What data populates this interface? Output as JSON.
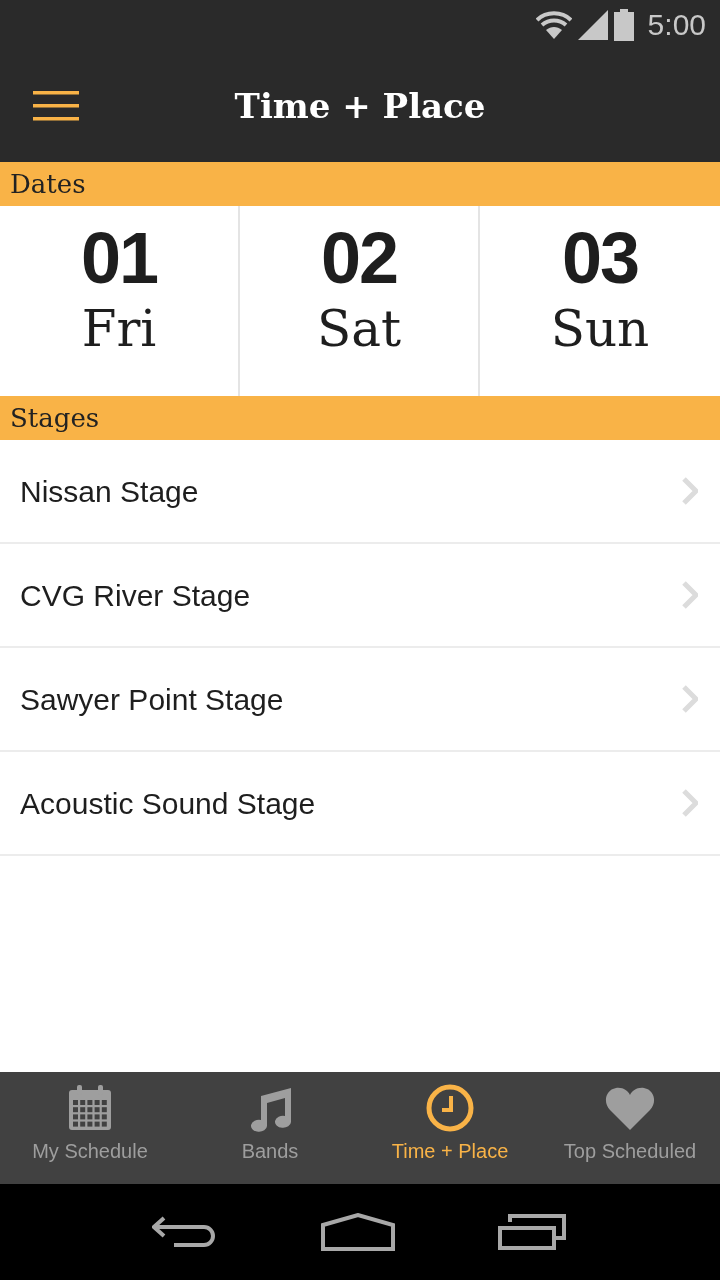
{
  "status_bar": {
    "time": "5:00"
  },
  "app_bar": {
    "title": "Time + Place"
  },
  "dates": {
    "header": "Dates",
    "items": [
      {
        "number": "01",
        "day": "Fri"
      },
      {
        "number": "02",
        "day": "Sat"
      },
      {
        "number": "03",
        "day": "Sun"
      }
    ]
  },
  "stages": {
    "header": "Stages",
    "items": [
      {
        "name": "Nissan Stage"
      },
      {
        "name": "CVG River Stage"
      },
      {
        "name": "Sawyer Point Stage"
      },
      {
        "name": "Acoustic Sound Stage"
      }
    ]
  },
  "tab_bar": {
    "items": [
      {
        "label": "My Schedule",
        "kind": "calendar",
        "selected": false
      },
      {
        "label": "Bands",
        "kind": "music",
        "selected": false
      },
      {
        "label": "Time + Place",
        "kind": "clock",
        "selected": true
      },
      {
        "label": "Top Scheduled",
        "kind": "heart",
        "selected": false
      }
    ]
  }
}
